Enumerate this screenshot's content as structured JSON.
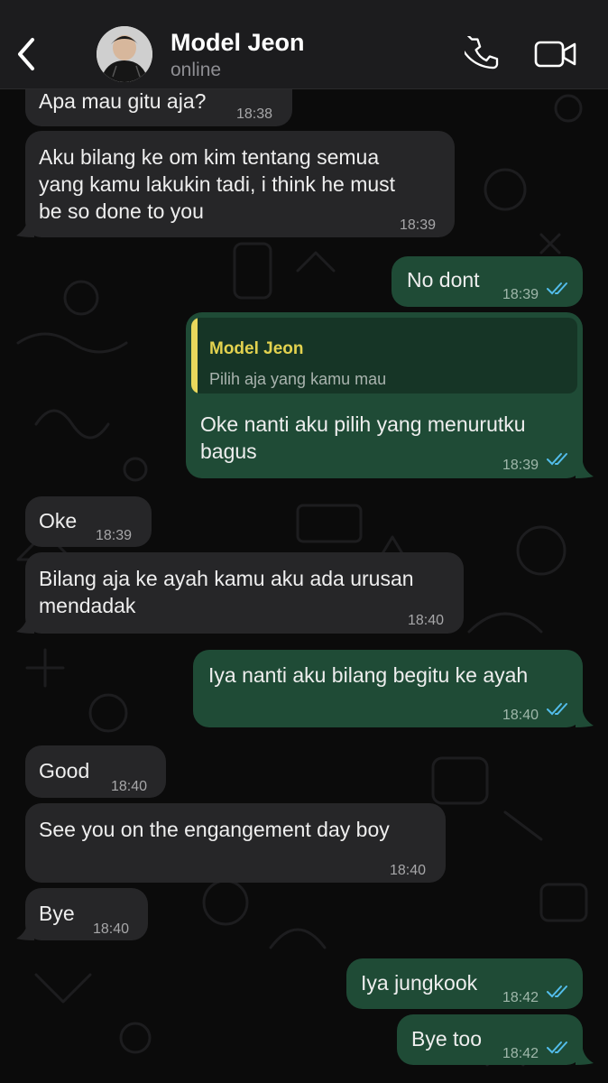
{
  "header": {
    "back_icon": "chevron-left-icon",
    "contact_name": "Model Jeon",
    "status": "online",
    "call_icon": "phone-icon",
    "video_icon": "video-camera-icon"
  },
  "colors": {
    "incoming_bubble": "#262628",
    "outgoing_bubble": "#1f4b36",
    "quote_accent": "#e3d24f",
    "read_ticks": "#53bdeb"
  },
  "messages": [
    {
      "direction": "in",
      "text_lines": [
        "Apa mau gitu aja?"
      ],
      "time": "18:38"
    },
    {
      "direction": "in",
      "text_lines": [
        "Aku bilang ke om kim tentang semua",
        "yang kamu lakukin tadi, i think he must",
        "be so done to you"
      ],
      "time": "18:39"
    },
    {
      "direction": "out",
      "text_lines": [
        "No dont"
      ],
      "time": "18:39",
      "read": true
    },
    {
      "direction": "out",
      "reply_to": {
        "name": "Model Jeon",
        "text": "Pilih aja yang kamu mau"
      },
      "text_lines": [
        "Oke nanti aku pilih yang menurutku",
        "bagus"
      ],
      "time": "18:39",
      "read": true
    },
    {
      "direction": "in",
      "text_lines": [
        "Oke"
      ],
      "time": "18:39"
    },
    {
      "direction": "in",
      "text_lines": [
        "Bilang aja ke ayah kamu aku ada urusan",
        "mendadak"
      ],
      "time": "18:40"
    },
    {
      "direction": "out",
      "text_lines": [
        "Iya nanti aku bilang begitu ke ayah"
      ],
      "time": "18:40",
      "read": true
    },
    {
      "direction": "in",
      "text_lines": [
        "Good"
      ],
      "time": "18:40"
    },
    {
      "direction": "in",
      "text_lines": [
        "See you on the engangement day boy"
      ],
      "time": "18:40"
    },
    {
      "direction": "in",
      "text_lines": [
        "Bye"
      ],
      "time": "18:40"
    },
    {
      "direction": "out",
      "text_lines": [
        "Iya jungkook"
      ],
      "time": "18:42",
      "read": true
    },
    {
      "direction": "out",
      "text_lines": [
        "Bye too"
      ],
      "time": "18:42",
      "read": true
    }
  ]
}
